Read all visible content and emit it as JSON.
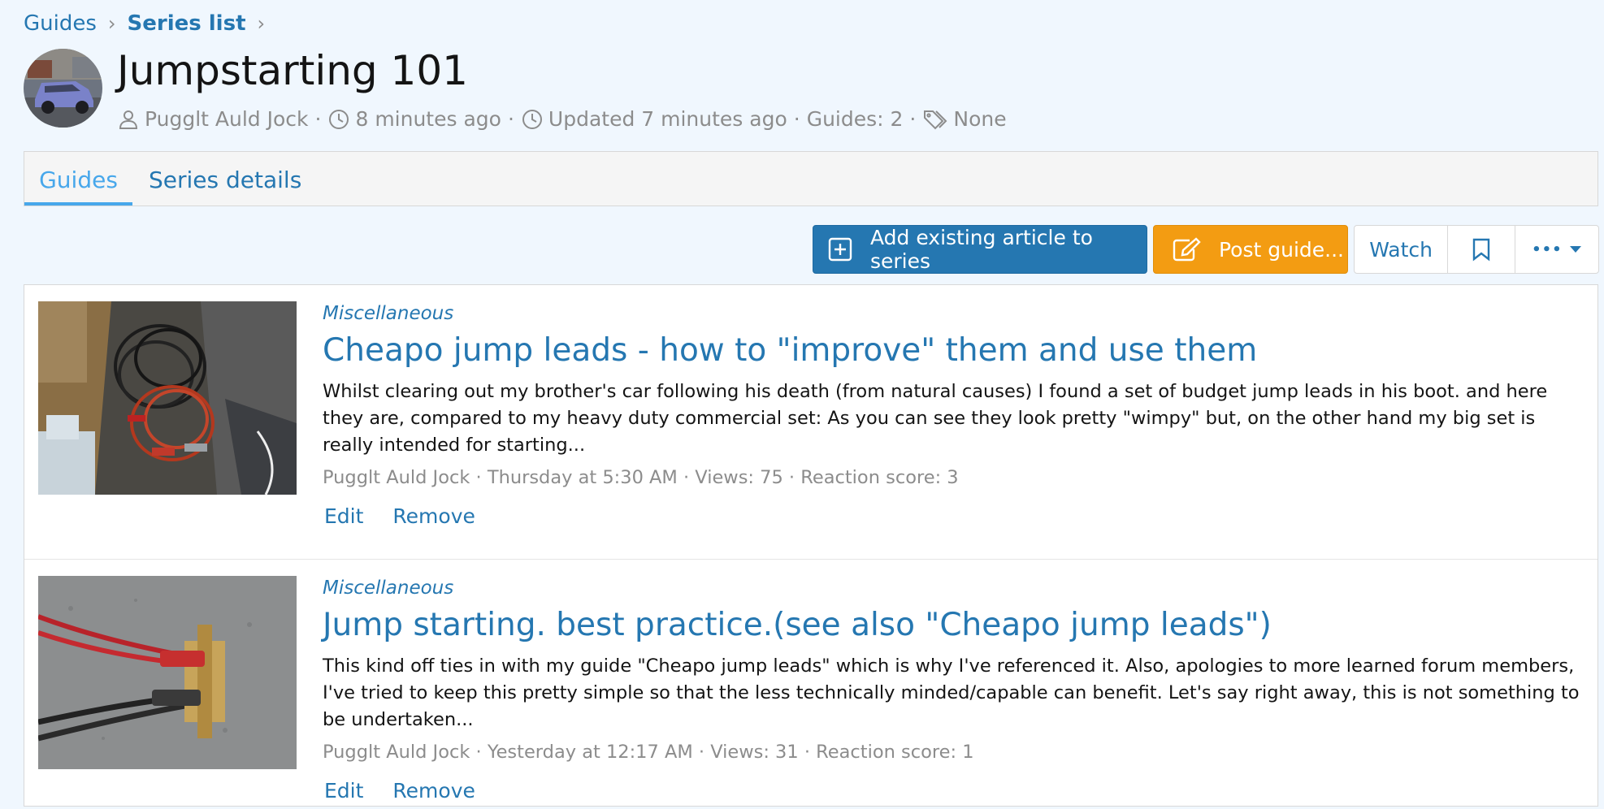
{
  "breadcrumb": {
    "items": [
      {
        "label": "Guides"
      },
      {
        "label": "Series list"
      }
    ]
  },
  "page": {
    "title": "Jumpstarting 101"
  },
  "meta": {
    "author": "Pugglt Auld Jock",
    "created": "8 minutes ago",
    "updated": "Updated 7 minutes ago",
    "guides": "Guides: 2",
    "tags": "None",
    "sep": "·"
  },
  "tabs": [
    {
      "label": "Guides",
      "active": true
    },
    {
      "label": "Series details",
      "active": false
    }
  ],
  "toolbar": {
    "add_label": "Add existing article to series",
    "post_label": "Post guide...",
    "watch_label": "Watch",
    "more_label": "•••"
  },
  "colors": {
    "accent": "#2577b1",
    "cta": "#f39c12",
    "tab_active": "#47a7eb",
    "page_bg": "#f0f7fe"
  },
  "guides": [
    {
      "category": "Miscellaneous",
      "title": "Cheapo jump leads - how to \"improve\" them and use them",
      "snippet": "Whilst clearing out my brother's car following his death (from natural causes) I found a set of budget jump leads in his boot. and here they are, compared to my heavy duty commercial set: As you can see they look pretty \"wimpy\" but, on the other hand my big set is really intended for starting...",
      "meta": "Pugglt Auld Jock · Thursday at 5:30 AM · Views: 75 · Reaction score: 3",
      "edit": "Edit",
      "remove": "Remove"
    },
    {
      "category": "Miscellaneous",
      "title": "Jump starting. best practice.(see also \"Cheapo jump leads\")",
      "snippet": "This kind off ties in with my guide \"Cheapo jump leads\" which is why I've referenced it. Also, apologies to more learned forum members, I've tried to keep this pretty simple so that the less technically minded/capable can benefit. Let's say right away, this is not something to be undertaken...",
      "meta": "Pugglt Auld Jock · Yesterday at 12:17 AM · Views: 31 · Reaction score: 1",
      "edit": "Edit",
      "remove": "Remove"
    }
  ]
}
